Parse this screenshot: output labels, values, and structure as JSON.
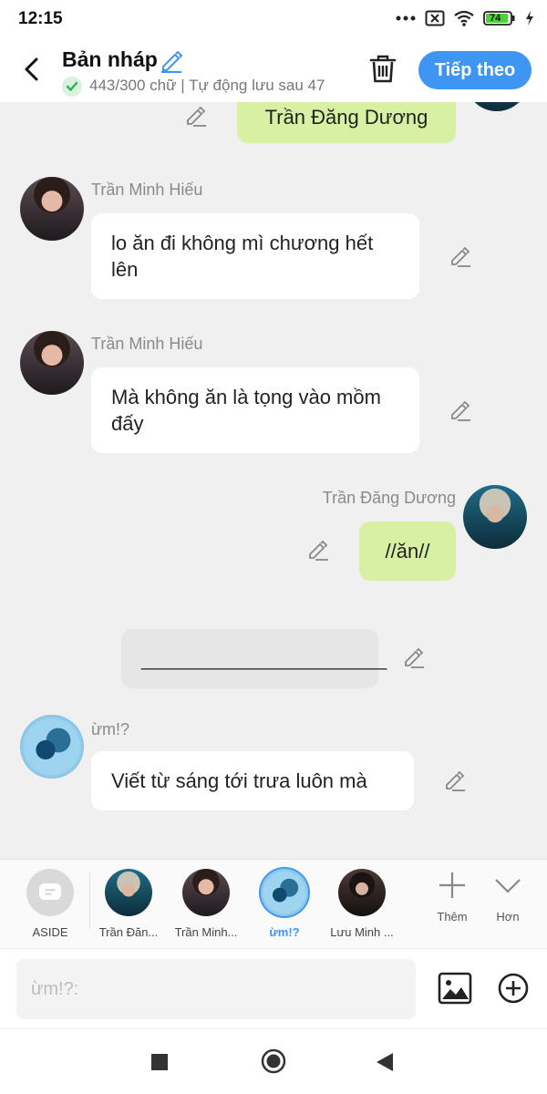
{
  "status_bar": {
    "time": "12:15",
    "battery": "74",
    "icons": [
      "more-icon",
      "close-box-icon",
      "wifi-icon",
      "battery-icon",
      "charging-icon"
    ]
  },
  "header": {
    "title": "Bản nháp",
    "subtitle": "443/300 chữ | Tự động lưu sau 47",
    "next_label": "Tiếp theo"
  },
  "messages": [
    {
      "side": "right",
      "name": "",
      "text": "Trần Đăng Dương"
    },
    {
      "side": "left",
      "name": "Trần Minh Hiếu",
      "text": "lo ăn đi không mì chương hết lên"
    },
    {
      "side": "left",
      "name": "Trần Minh Hiếu",
      "text": "Mà không ăn là tọng vào mồm đấy"
    },
    {
      "side": "right",
      "name": "Trần Đăng Dương",
      "text": "//ăn//"
    },
    {
      "side": "aside",
      "name": "",
      "text": "______________________"
    },
    {
      "side": "left",
      "name": "ừm!?",
      "text": "Viết từ sáng tới trưa luôn mà"
    }
  ],
  "characters": [
    {
      "label": "ASIDE",
      "active": false
    },
    {
      "label": "Trần Đăn...",
      "active": false
    },
    {
      "label": "Trần Minh...",
      "active": false
    },
    {
      "label": "ừm!?",
      "active": true
    },
    {
      "label": "Lưu Minh ...",
      "active": false
    }
  ],
  "tools": {
    "add_label": "Thêm",
    "more_label": "Hơn"
  },
  "input": {
    "placeholder": "ừm!?:"
  },
  "colors": {
    "accent": "#3f95f2",
    "right_bubble": "#d8f0a4",
    "left_bubble": "#ffffff",
    "aside_bubble": "#e6e6e6",
    "battery": "#4cd137"
  }
}
